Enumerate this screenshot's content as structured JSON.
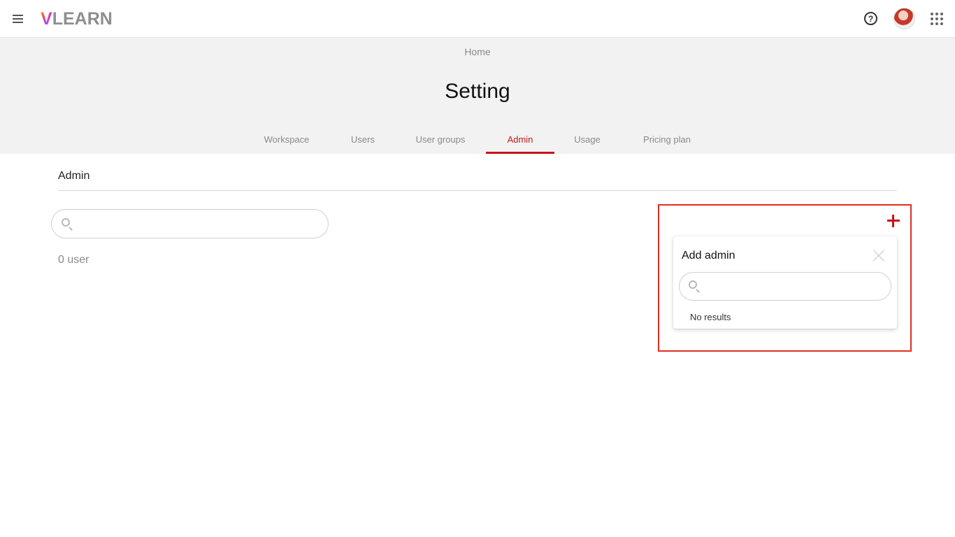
{
  "header": {
    "logo_v": "V",
    "logo_rest": "LEARN",
    "help_symbol": "?"
  },
  "breadcrumb": "Home",
  "page_title": "Setting",
  "tabs": [
    {
      "label": "Workspace",
      "active": false
    },
    {
      "label": "Users",
      "active": false
    },
    {
      "label": "User groups",
      "active": false
    },
    {
      "label": "Admin",
      "active": true
    },
    {
      "label": "Usage",
      "active": false
    },
    {
      "label": "Pricing plan",
      "active": false
    }
  ],
  "section": {
    "title": "Admin",
    "search_value": "",
    "user_count": "0 user"
  },
  "add_admin_popup": {
    "title": "Add admin",
    "search_value": "",
    "empty_text": "No results"
  },
  "colors": {
    "accent": "#c4161c",
    "highlight_box": "#e02e1f",
    "band_bg": "#f2f2f2",
    "muted_text": "#8a8a8a"
  },
  "icons": [
    "menu-icon",
    "help-icon",
    "avatar",
    "apps-grid-icon",
    "search-icon",
    "plus-icon",
    "close-icon"
  ]
}
